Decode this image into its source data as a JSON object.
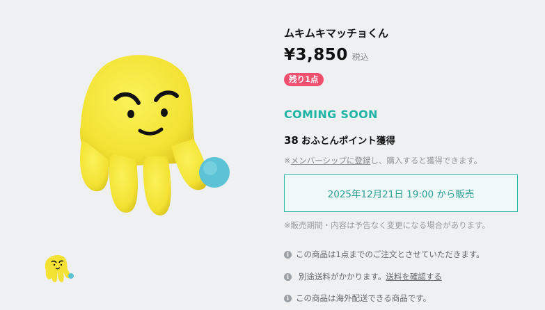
{
  "product": {
    "title": "ムキムキマッチョくん",
    "price": "¥3,850",
    "tax_label": "税込",
    "stock_badge": "残り1点",
    "status": "COMING SOON",
    "points_number": "38",
    "points_label": "おふとんポイント獲得",
    "member_note_prefix": "※",
    "member_link": "メンバーシップに登録",
    "member_note_suffix": "し、購入すると獲得できます。",
    "sale_start": "2025年12月21日 19:00 から販売",
    "period_note": "※販売期間・内容は予告なく変更になる場合があります。",
    "notices": [
      {
        "text": "この商品は1点までのご注文とさせていただきます。"
      },
      {
        "text": "別途送料がかかります。",
        "link": "送料を確認する"
      },
      {
        "text": "この商品は海外配送できる商品です。"
      }
    ]
  },
  "colors": {
    "accent": "#1fb5a5",
    "badge": "#f0506e",
    "plush": "#f5e63a"
  },
  "icons": {
    "info": "info-circle-icon"
  }
}
